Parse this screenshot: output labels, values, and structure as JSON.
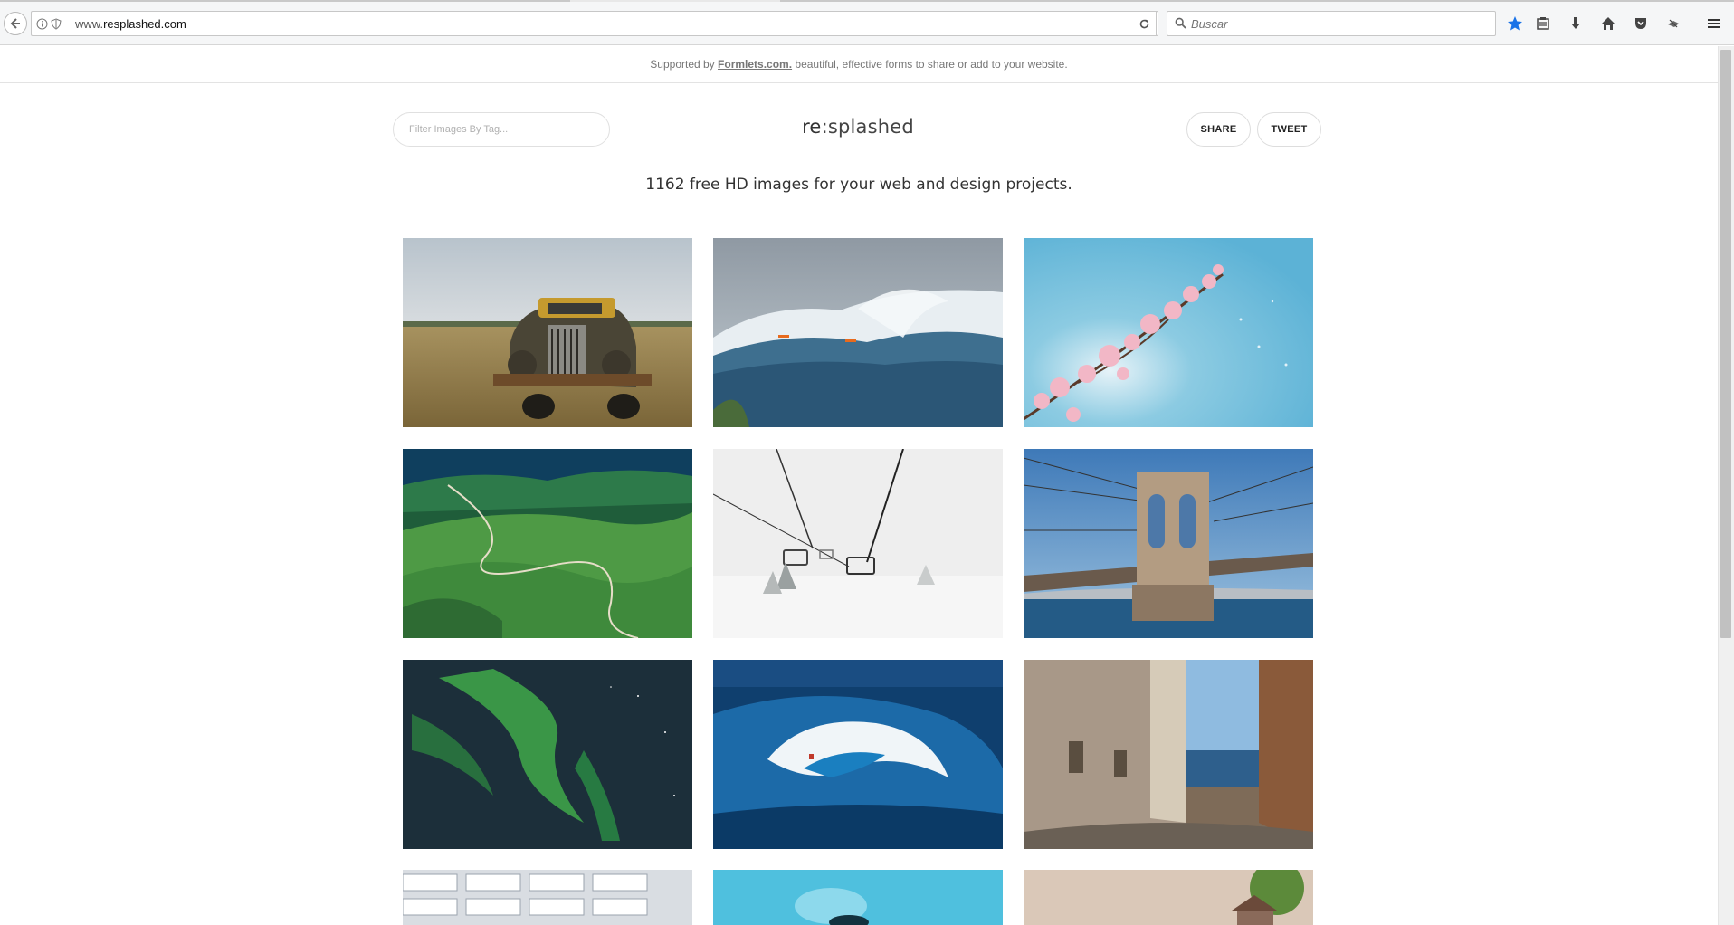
{
  "browser": {
    "url_prefix": "www.",
    "url_domain": "resplashed.com",
    "search_placeholder": "Buscar",
    "accent": "#1a73e8"
  },
  "banner": {
    "lead": "Supported by",
    "link": "Formlets.com.",
    "tail": "beautiful, effective forms to share or add to your website."
  },
  "header": {
    "filter_placeholder": "Filter Images By Tag...",
    "logo_prefix": "re",
    "logo_suffix": ":splashed",
    "share_label": "SHARE",
    "tweet_label": "TWEET"
  },
  "tagline": "1162 free HD images for your web and design projects.",
  "images": [
    {
      "name": "vintage-truck-image"
    },
    {
      "name": "surfer-wave-image"
    },
    {
      "name": "cherry-blossom-image"
    },
    {
      "name": "green-hills-road-image"
    },
    {
      "name": "ski-lift-snow-image"
    },
    {
      "name": "brooklyn-bridge-image"
    },
    {
      "name": "aurora-image"
    },
    {
      "name": "barrel-wave-image"
    },
    {
      "name": "old-street-image"
    },
    {
      "name": "white-building-image"
    },
    {
      "name": "blue-water-image"
    },
    {
      "name": "house-tree-image"
    }
  ]
}
